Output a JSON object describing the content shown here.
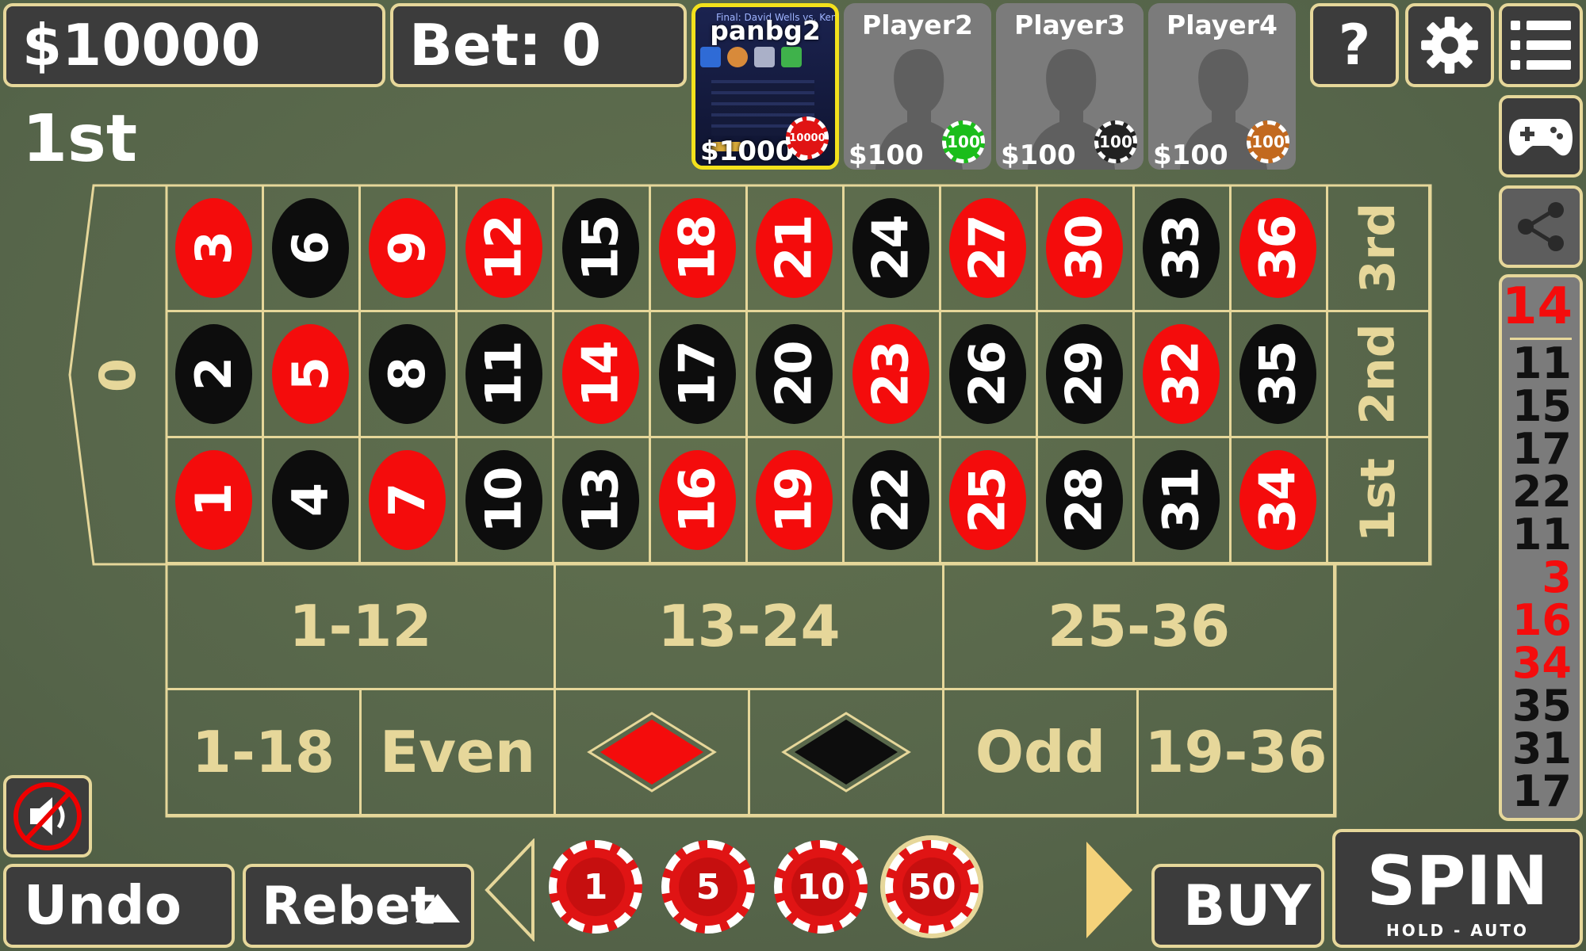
{
  "top_bar": {
    "balance": "$10000",
    "bet": "Bet: 0",
    "round": "1st"
  },
  "players": [
    {
      "name": "panbg2",
      "money": "$10000",
      "chip": "10000",
      "chip_color": "#e01414",
      "active": true,
      "thumb_title": "Final: David Wells vs. Kentaro"
    },
    {
      "name": "Player2",
      "money": "$100",
      "chip": "100",
      "chip_color": "#1bbd1b",
      "active": false
    },
    {
      "name": "Player3",
      "money": "$100",
      "chip": "100",
      "chip_color": "#222222",
      "active": false
    },
    {
      "name": "Player4",
      "money": "$100",
      "chip": "100",
      "chip_color": "#c2691f",
      "active": false
    }
  ],
  "icons": {
    "help": "?",
    "settings": "gear-icon",
    "menu": "menu-icon",
    "gamepad": "gamepad-icon",
    "share": "share-icon",
    "mute": "speaker-muted-icon"
  },
  "board": {
    "zero": "0",
    "rows": [
      [
        {
          "n": "3",
          "c": "red"
        },
        {
          "n": "6",
          "c": "black"
        },
        {
          "n": "9",
          "c": "red"
        },
        {
          "n": "12",
          "c": "red"
        },
        {
          "n": "15",
          "c": "black"
        },
        {
          "n": "18",
          "c": "red"
        },
        {
          "n": "21",
          "c": "red"
        },
        {
          "n": "24",
          "c": "black"
        },
        {
          "n": "27",
          "c": "red"
        },
        {
          "n": "30",
          "c": "red"
        },
        {
          "n": "33",
          "c": "black"
        },
        {
          "n": "36",
          "c": "red"
        }
      ],
      [
        {
          "n": "2",
          "c": "black"
        },
        {
          "n": "5",
          "c": "red"
        },
        {
          "n": "8",
          "c": "black"
        },
        {
          "n": "11",
          "c": "black"
        },
        {
          "n": "14",
          "c": "red"
        },
        {
          "n": "17",
          "c": "black"
        },
        {
          "n": "20",
          "c": "black"
        },
        {
          "n": "23",
          "c": "red"
        },
        {
          "n": "26",
          "c": "black"
        },
        {
          "n": "29",
          "c": "black"
        },
        {
          "n": "32",
          "c": "red"
        },
        {
          "n": "35",
          "c": "black"
        }
      ],
      [
        {
          "n": "1",
          "c": "red"
        },
        {
          "n": "4",
          "c": "black"
        },
        {
          "n": "7",
          "c": "red"
        },
        {
          "n": "10",
          "c": "black"
        },
        {
          "n": "13",
          "c": "black"
        },
        {
          "n": "16",
          "c": "red"
        },
        {
          "n": "19",
          "c": "red"
        },
        {
          "n": "22",
          "c": "black"
        },
        {
          "n": "25",
          "c": "red"
        },
        {
          "n": "28",
          "c": "black"
        },
        {
          "n": "31",
          "c": "black"
        },
        {
          "n": "34",
          "c": "red"
        }
      ]
    ],
    "columns": [
      "3rd",
      "2nd",
      "1st"
    ],
    "dozens": [
      "1-12",
      "13-24",
      "25-36"
    ],
    "even_money": {
      "low": "1-18",
      "even": "Even",
      "odd": "Odd",
      "high": "19-36"
    },
    "colors": {
      "red": "#f40c0c",
      "black": "#0d0d0d",
      "line": "#e6d79a"
    }
  },
  "history": {
    "latest": "14",
    "latest_color": "red",
    "items": [
      {
        "n": "11",
        "c": "black"
      },
      {
        "n": "15",
        "c": "black"
      },
      {
        "n": "17",
        "c": "black"
      },
      {
        "n": "22",
        "c": "black"
      },
      {
        "n": "11",
        "c": "black"
      },
      {
        "n": "3",
        "c": "red"
      },
      {
        "n": "16",
        "c": "red"
      },
      {
        "n": "34",
        "c": "red"
      },
      {
        "n": "35",
        "c": "black"
      },
      {
        "n": "31",
        "c": "black"
      },
      {
        "n": "17",
        "c": "black"
      }
    ]
  },
  "bottom_bar": {
    "undo": "Undo",
    "rebet": "Rebet",
    "chips": [
      "1",
      "5",
      "10",
      "50"
    ],
    "selected_chip": "50",
    "buy": "BUY",
    "spin": "SPIN",
    "spin_sub": "HOLD - AUTO"
  }
}
